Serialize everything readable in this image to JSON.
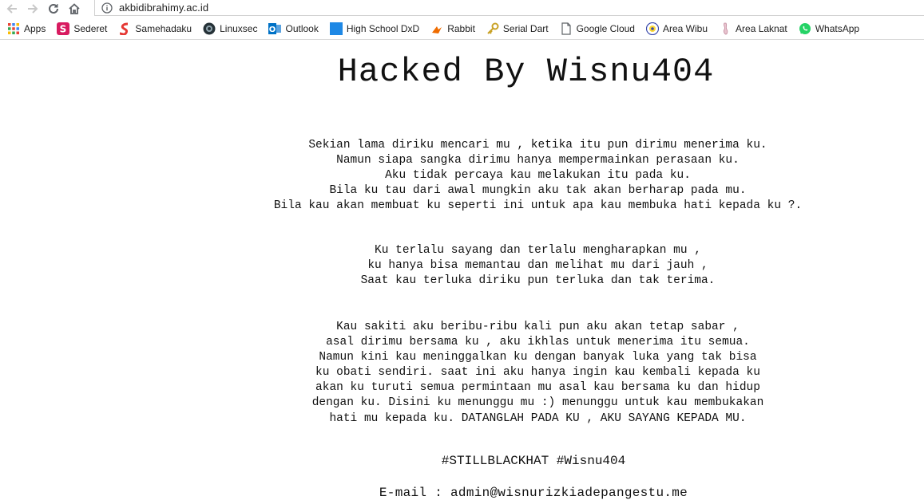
{
  "browser": {
    "url": "akbidibrahimy.ac.id",
    "colors": {
      "toolbar_bg": "#ffffff",
      "icon": "#5f6368"
    },
    "bookmarks": [
      {
        "label": "Apps",
        "icon": "apps-grid-icon",
        "color": "#4285f4"
      },
      {
        "label": "Sederet",
        "icon": "sederet-icon",
        "color": "#d81b60"
      },
      {
        "label": "Samehadaku",
        "icon": "samehadaku-icon",
        "color": "#e53935"
      },
      {
        "label": "Linuxsec",
        "icon": "linuxsec-icon",
        "color": "#263238"
      },
      {
        "label": "Outlook",
        "icon": "outlook-icon",
        "color": "#0072c6"
      },
      {
        "label": "High School DxD",
        "icon": "blue-square-icon",
        "color": "#1e88e5"
      },
      {
        "label": "Rabbit",
        "icon": "rabbit-icon",
        "color": "#ef6c00"
      },
      {
        "label": "Serial Dart",
        "icon": "key-icon",
        "color": "#c9a227"
      },
      {
        "label": "Google Cloud",
        "icon": "page-icon",
        "color": "#5f6368"
      },
      {
        "label": "Area Wibu",
        "icon": "wibu-icon",
        "color": "#3949ab"
      },
      {
        "label": "Area Laknat",
        "icon": "laknat-icon",
        "color": "#c48b9f"
      },
      {
        "label": "WhatsApp",
        "icon": "whatsapp-icon",
        "color": "#25d366"
      }
    ]
  },
  "page": {
    "title": "Hacked By Wisnu404",
    "paragraph1": [
      "Sekian lama diriku mencari mu , ketika itu pun dirimu menerima ku.",
      "Namun siapa sangka dirimu hanya mempermainkan perasaan ku.",
      "Aku tidak percaya kau melakukan itu pada ku.",
      "Bila ku tau dari awal mungkin aku tak akan berharap pada mu.",
      "Bila kau akan membuat ku seperti ini untuk apa kau membuka hati kepada ku ?."
    ],
    "paragraph2": [
      "Ku terlalu sayang dan terlalu mengharapkan mu ,",
      "ku hanya bisa memantau dan melihat mu dari jauh ,",
      "Saat kau terluka diriku pun terluka dan tak terima."
    ],
    "paragraph3": [
      "Kau sakiti aku beribu-ribu kali pun aku akan tetap sabar ,",
      "asal dirimu bersama ku , aku ikhlas untuk menerima itu semua.",
      "Namun kini kau meninggalkan ku dengan banyak luka yang tak bisa",
      "ku obati sendiri. saat ini aku hanya ingin kau kembali kepada ku",
      "akan ku turuti semua permintaan mu asal kau bersama ku dan hidup",
      "dengan ku. Disini ku menunggu mu :) menunggu untuk kau membukakan",
      "hati mu kepada ku. DATANGLAH PADA KU , AKU SAYANG KEPADA MU."
    ],
    "hashtag": "#STILLBLACKHAT #Wisnu404",
    "email": "E-mail : admin@wisnurizkiadepangestu.me"
  }
}
